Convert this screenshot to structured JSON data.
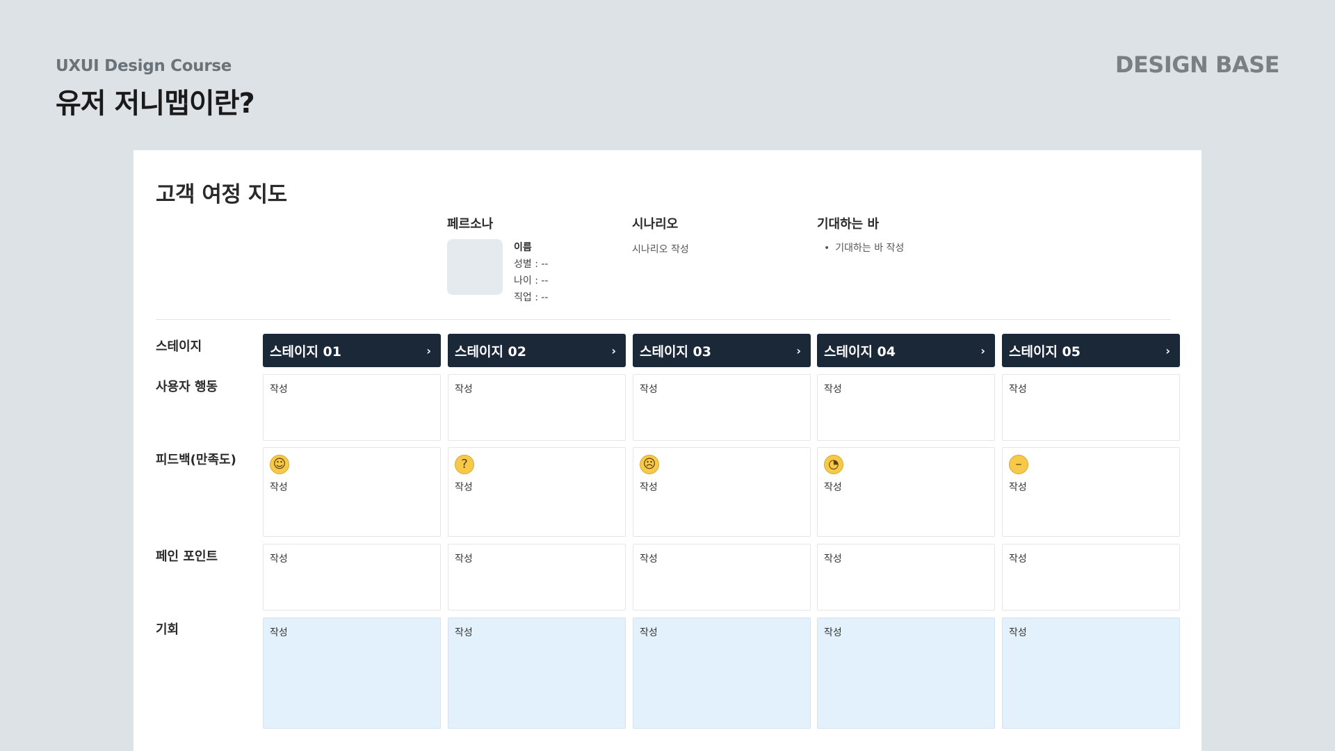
{
  "header": {
    "course": "UXUI Design Course",
    "title": "유저 저니맵이란?",
    "logo": "DESIGN BASE"
  },
  "card": {
    "title": "고객 여정 지도",
    "persona": {
      "heading": "페르소나",
      "name_label": "이름",
      "gender": "성별 : --",
      "age": "나이 : --",
      "job": "직업 : --"
    },
    "scenario": {
      "heading": "시나리오",
      "text": "시나리오 작성"
    },
    "expectation": {
      "heading": "기대하는 바",
      "bullet": "기대하는 바 작성"
    },
    "row_labels": {
      "stage": "스테이지",
      "actions": "사용자 행동",
      "feedback": "피드백(만족도)",
      "pain": "페인 포인트",
      "opportunity": "기회"
    },
    "stages": [
      {
        "label": "스테이지 01",
        "arrow": "›"
      },
      {
        "label": "스테이지 02",
        "arrow": "›"
      },
      {
        "label": "스테이지 03",
        "arrow": "›"
      },
      {
        "label": "스테이지 04",
        "arrow": "›"
      },
      {
        "label": "스테이지 05",
        "arrow": "›"
      }
    ],
    "cell_text": "작성",
    "feedback_emojis": [
      {
        "icon": "smiling-face-icon",
        "glyph": "☺"
      },
      {
        "icon": "thinking-face-icon",
        "glyph": "?"
      },
      {
        "icon": "frowning-face-icon",
        "glyph": "☹"
      },
      {
        "icon": "eye-roll-face-icon",
        "glyph": "◔"
      },
      {
        "icon": "neutral-face-icon",
        "glyph": "–"
      }
    ]
  }
}
